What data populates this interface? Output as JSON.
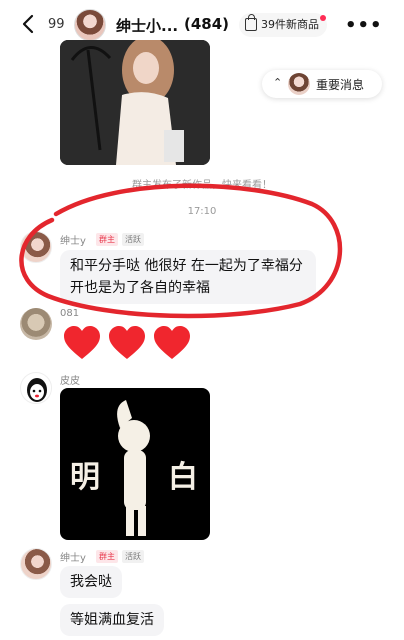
{
  "header": {
    "back_count": "99",
    "group_name": "绅士小...",
    "member_count": "(484)",
    "new_products": "39件新商品"
  },
  "important_pill": {
    "label": "重要消息"
  },
  "system_notice": "群主发布了新作品，快来看看！",
  "timestamp": "17:10",
  "messages": [
    {
      "sender": "绅士y",
      "badges": [
        "群主",
        "活跃"
      ],
      "text": "和平分手哒  他很好  在一起为了幸福分开也是为了各自的幸福"
    },
    {
      "sender": "081",
      "hearts": 3
    },
    {
      "sender": "皮皮",
      "image_chars": [
        "明",
        "白"
      ]
    },
    {
      "sender": "绅士y",
      "badges": [
        "群主",
        "活跃"
      ],
      "texts": [
        "我会哒",
        "等姐满血复活"
      ]
    }
  ],
  "watermark": "",
  "colors": {
    "accent_red": "#e8394d",
    "bubble_bg": "#f4f4f6",
    "annotation_red": "#e3262d"
  }
}
